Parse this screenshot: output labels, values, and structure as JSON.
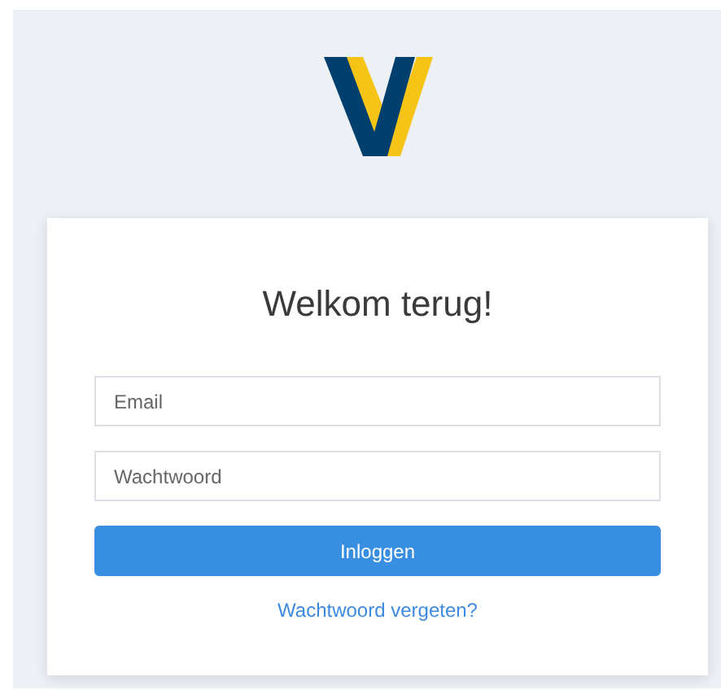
{
  "title": "Welkom terug!",
  "fields": [
    {
      "placeholder": "Email"
    },
    {
      "placeholder": "Wachtwoord"
    }
  ],
  "button": "Inloggen",
  "link": "Wachtwoord vergeten?"
}
